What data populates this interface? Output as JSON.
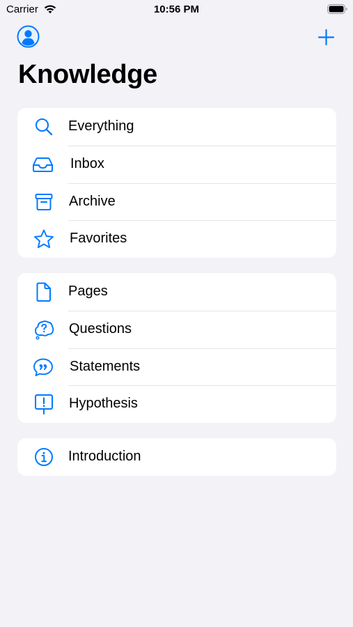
{
  "status_bar": {
    "carrier": "Carrier",
    "time": "10:56 PM"
  },
  "nav": {
    "title": "Knowledge",
    "accent_color": "#007aff"
  },
  "sections": [
    {
      "items": [
        {
          "label": "Everything",
          "icon": "search-icon"
        },
        {
          "label": "Inbox",
          "icon": "tray-icon"
        },
        {
          "label": "Archive",
          "icon": "archive-box-icon"
        },
        {
          "label": "Favorites",
          "icon": "star-icon"
        }
      ]
    },
    {
      "items": [
        {
          "label": "Pages",
          "icon": "document-icon"
        },
        {
          "label": "Questions",
          "icon": "question-bubble-icon"
        },
        {
          "label": "Statements",
          "icon": "quote-bubble-icon"
        },
        {
          "label": "Hypothesis",
          "icon": "exclamation-sign-icon"
        }
      ]
    },
    {
      "items": [
        {
          "label": "Introduction",
          "icon": "info-circle-icon"
        }
      ]
    }
  ]
}
